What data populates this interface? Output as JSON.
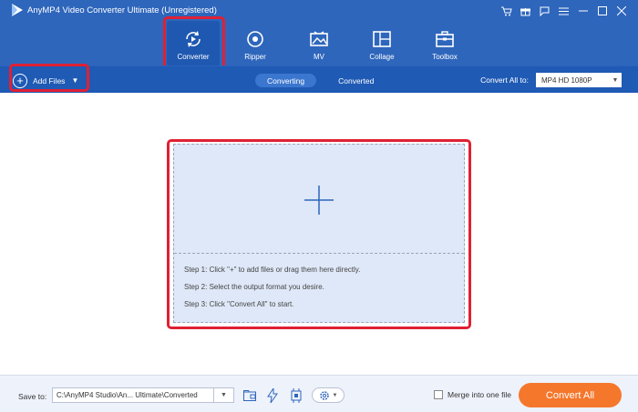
{
  "app": {
    "title": "AnyMP4 Video Converter Ultimate (Unregistered)"
  },
  "window_controls": [
    "cart-icon",
    "gift-icon",
    "feedback-icon",
    "menu-icon",
    "minimize-icon",
    "maximize-icon",
    "close-icon"
  ],
  "toolbar": {
    "items": [
      {
        "label": "Converter",
        "icon": "converter-icon",
        "active": true
      },
      {
        "label": "Ripper",
        "icon": "ripper-icon",
        "active": false
      },
      {
        "label": "MV",
        "icon": "mv-icon",
        "active": false
      },
      {
        "label": "Collage",
        "icon": "collage-icon",
        "active": false
      },
      {
        "label": "Toolbox",
        "icon": "toolbox-icon",
        "active": false
      }
    ]
  },
  "subbar": {
    "add_files_label": "Add Files",
    "tabs": [
      {
        "label": "Converting",
        "active": true
      },
      {
        "label": "Converted",
        "active": false
      }
    ],
    "convert_all_to_label": "Convert All to:",
    "format_value": "MP4 HD 1080P"
  },
  "dropzone": {
    "steps": [
      "Step 1: Click \"+\" to add files or drag them here directly.",
      "Step 2: Select the output format you desire.",
      "Step 3: Click \"Convert All\" to start."
    ]
  },
  "footer": {
    "save_to_label": "Save to:",
    "path_value": "C:\\AnyMP4 Studio\\An... Ultimate\\Converted",
    "merge_label": "Merge into one file",
    "merge_checked": false,
    "convert_all_label": "Convert All"
  },
  "colors": {
    "header_bg": "#2e66bc",
    "subbar_bg": "#1f5ab5",
    "accent_orange": "#f5772c",
    "highlight_red": "#e02034",
    "dropzone_bg": "#dfe8f8"
  }
}
